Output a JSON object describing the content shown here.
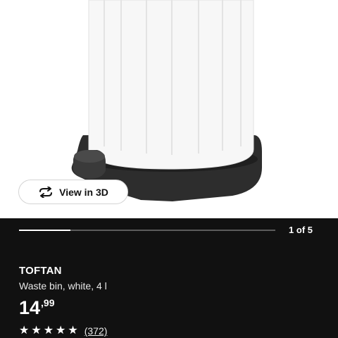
{
  "gallery": {
    "view_3d_label": "View in 3D",
    "page_indicator": "1 of 5",
    "progress_fraction": 0.2
  },
  "product": {
    "name": "TOFTAN",
    "description": "Waste bin, white, 4 l",
    "price_integer": "14",
    "price_decimal": ",99",
    "rating_stars": 5,
    "review_count": "(372)"
  },
  "colors": {
    "panel_bg": "#111111",
    "bin_body": "#f7f7f7",
    "bin_base": "#2d2d2d"
  },
  "icons": {
    "view_3d": "rotate-arrows-icon",
    "star": "star-icon"
  }
}
